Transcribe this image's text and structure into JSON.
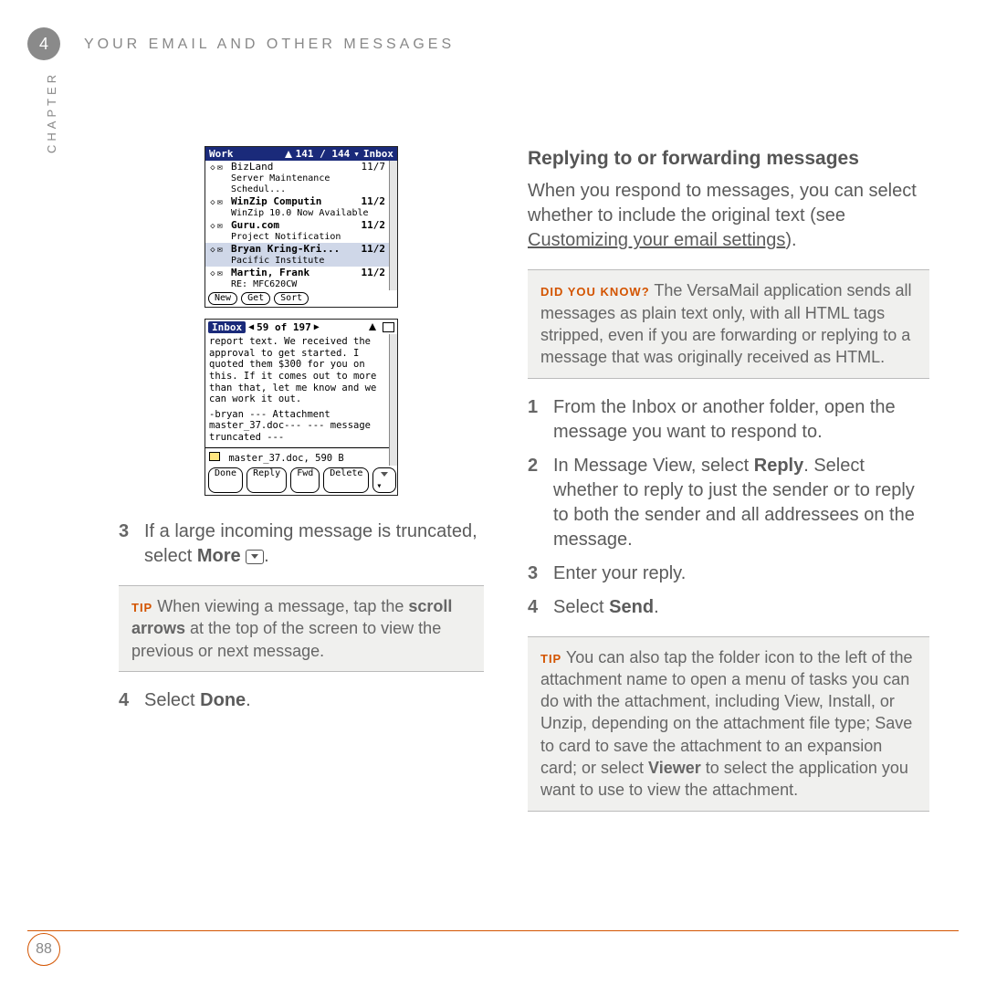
{
  "header": {
    "chapter_num": "4",
    "title": "YOUR EMAIL AND OTHER MESSAGES",
    "side_label": "CHAPTER"
  },
  "footer": {
    "page": "88"
  },
  "palm_inbox": {
    "account": "Work",
    "counter": "141 / 144",
    "folder": "Inbox",
    "rows": [
      {
        "sender": "BizLand",
        "date": "11/7",
        "subject": "Server Maintenance Schedul...",
        "bold": false
      },
      {
        "sender": "WinZip Computin",
        "date": "11/2",
        "subject": "WinZip 10.0 Now Available",
        "bold": true
      },
      {
        "sender": "Guru.com",
        "date": "11/2",
        "subject": "Project Notification",
        "bold": true
      },
      {
        "sender": "Bryan Kring-Kri...",
        "date": "11/2",
        "subject": "Pacific Institute",
        "bold": true,
        "selected": true
      },
      {
        "sender": "Martin, Frank",
        "date": "11/2",
        "subject": "RE: MFC620CW",
        "bold": true
      }
    ],
    "buttons": [
      "New",
      "Get",
      "Sort"
    ]
  },
  "palm_msg": {
    "folder": "Inbox",
    "position": "59 of 197",
    "body": "report text. We received the approval to get started. I quoted them $300 for you on this. If it comes out to more than that, let me know and we can work it out.",
    "sig": "-bryan --- Attachment master_37.doc--- --- message truncated ---",
    "attachment": "master_37.doc, 590 B",
    "buttons": [
      "Done",
      "Reply",
      "Fwd",
      "Delete"
    ]
  },
  "left": {
    "step3_pre": "If a large incoming message is truncated, select ",
    "step3_bold": "More",
    "tip_label": "TIP",
    "tip_text_a": "When viewing a message, tap the ",
    "tip_bold": "scroll arrows",
    "tip_text_b": " at the top of the screen to view the previous or next message.",
    "step4_pre": "Select ",
    "step4_bold": "Done",
    "step4_post": "."
  },
  "right": {
    "title": "Replying to or forwarding messages",
    "intro_a": "When you respond to messages, you can select whether to include the original text (see ",
    "intro_link": "Customizing your email settings",
    "intro_b": ").",
    "dyk_label": "DID YOU KNOW?",
    "dyk_text": "The VersaMail application sends all messages as plain text only, with all HTML tags stripped, even if you are forwarding or replying to a message that was originally received as HTML.",
    "s1": "From the Inbox or another folder, open the message you want to respond to.",
    "s2_a": "In Message View, select ",
    "s2_bold": "Reply",
    "s2_b": ". Select whether to reply to just the sender or to reply to both the sender and all addressees on the message.",
    "s3": "Enter your reply.",
    "s4_a": "Select ",
    "s4_bold": "Send",
    "s4_b": ".",
    "tip2_label": "TIP",
    "tip2_a": "You can also tap the folder icon to the left of the attachment name to open a menu of tasks you can do with the attachment, including View, Install, or Unzip, depending on the attachment file type; Save to card to save the attachment to an expansion card; or select ",
    "tip2_bold": "Viewer",
    "tip2_b": " to select the application you want to use to view the attachment."
  }
}
